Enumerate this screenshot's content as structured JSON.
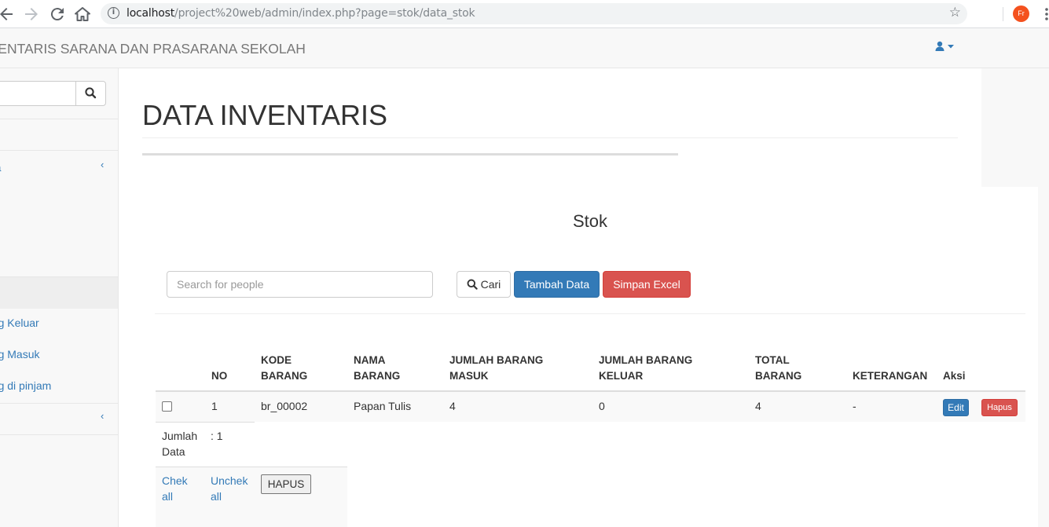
{
  "browser": {
    "back_icon": "arrow-left-icon",
    "forward_icon": "arrow-right-icon",
    "reload_icon": "reload-icon",
    "home_icon": "home-icon",
    "url_host": "localhost",
    "url_path": "/project%20web/admin/index.php?page=stok/data_stok",
    "profile_initials": "Fr"
  },
  "navbar": {
    "brand": "NVENTARIS SARANA DAN PRASARANA SEKOLAH",
    "user_icon": "user-icon"
  },
  "sidebar": {
    "menu_label_1": "ata",
    "submenu": [
      "ang Keluar",
      "ang Masuk",
      "ang di pinjam"
    ]
  },
  "page": {
    "title": "DATA INVENTARIS"
  },
  "panel": {
    "title": "Stok",
    "search_placeholder": "Search for people",
    "btn_cari": "Cari",
    "btn_tambah": "Tambah Data",
    "btn_excel": "Simpan Excel"
  },
  "table": {
    "headers": {
      "no": "NO",
      "kode_1": "KODE",
      "kode_2": "BARANG",
      "nama_1": "NAMA",
      "nama_2": "BARANG",
      "masuk_1": "JUMLAH BARANG",
      "masuk_2": "MASUK",
      "keluar_1": "JUMLAH BARANG",
      "keluar_2": "KELUAR",
      "total_1": "TOTAL",
      "total_2": "BARANG",
      "keterangan": "KETERANGAN",
      "aksi": "Aksi"
    },
    "rows": [
      {
        "no": "1",
        "kode": "br_00002",
        "nama": "Papan Tulis",
        "masuk": "4",
        "keluar": "0",
        "total": "4",
        "keterangan": "-",
        "edit": "Edit",
        "hapus": "Hapus"
      }
    ],
    "footer": {
      "jumlah_1": "Jumlah",
      "jumlah_2": "Data",
      "jumlah_value": ": 1",
      "check_all_1": "Chek",
      "check_all_2": "all",
      "uncheck_all_1": "Unchek",
      "uncheck_all_2": "all",
      "btn_hapus": "HAPUS"
    }
  }
}
